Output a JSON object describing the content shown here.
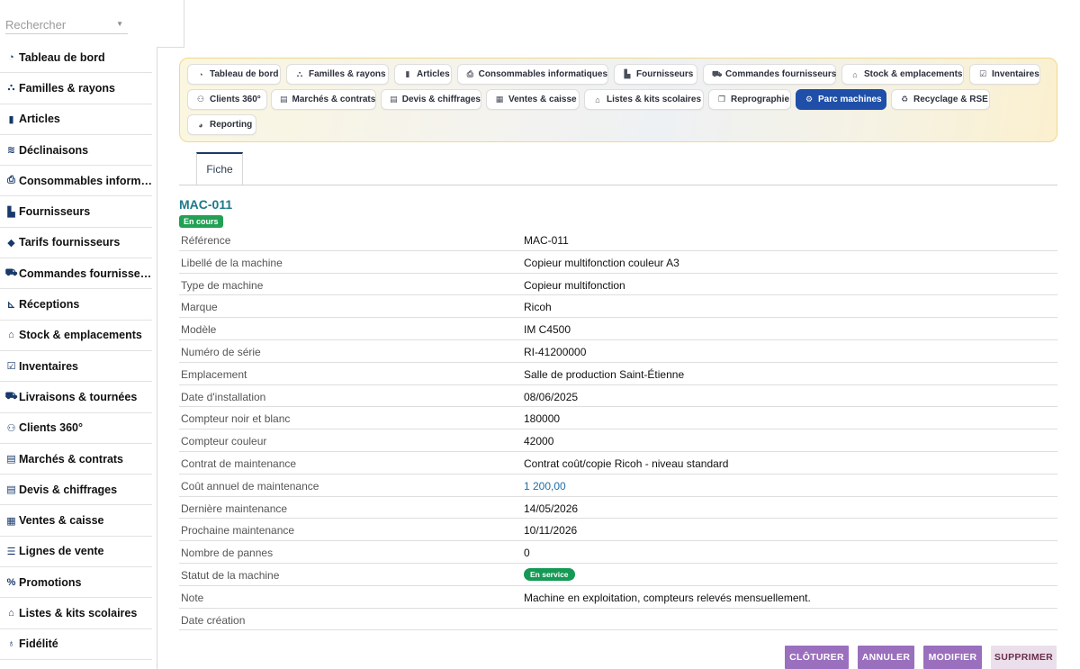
{
  "search": {
    "placeholder": "Rechercher"
  },
  "sidebar": {
    "items": [
      {
        "label": "Tableau de bord",
        "icon": "gauge-icon"
      },
      {
        "label": "Familles & rayons",
        "icon": "sitemap-icon"
      },
      {
        "label": "Articles",
        "icon": "book-icon"
      },
      {
        "label": "Déclinaisons",
        "icon": "layers-icon"
      },
      {
        "label": "Consommables informatiques",
        "icon": "printer-icon"
      },
      {
        "label": "Fournisseurs",
        "icon": "truck-loading-icon"
      },
      {
        "label": "Tarifs fournisseurs",
        "icon": "tags-icon"
      },
      {
        "label": "Commandes fournisseurs",
        "icon": "cart-icon"
      },
      {
        "label": "Réceptions",
        "icon": "dolly-icon"
      },
      {
        "label": "Stock & emplacements",
        "icon": "warehouse-icon"
      },
      {
        "label": "Inventaires",
        "icon": "clipboard-check-icon"
      },
      {
        "label": "Livraisons & tournées",
        "icon": "truck-icon"
      },
      {
        "label": "Clients 360°",
        "icon": "users-icon"
      },
      {
        "label": "Marchés & contrats",
        "icon": "contract-icon"
      },
      {
        "label": "Devis & chiffrages",
        "icon": "file-invoice-icon"
      },
      {
        "label": "Ventes & caisse",
        "icon": "cash-register-icon"
      },
      {
        "label": "Lignes de vente",
        "icon": "list-icon"
      },
      {
        "label": "Promotions",
        "icon": "percent-icon"
      },
      {
        "label": "Listes & kits scolaires",
        "icon": "graduation-cap-icon"
      },
      {
        "label": "Fidélité",
        "icon": "award-icon"
      }
    ]
  },
  "modules": [
    {
      "label": "Tableau de bord",
      "icon": "gauge-icon",
      "active": false
    },
    {
      "label": "Familles & rayons",
      "icon": "sitemap-icon",
      "active": false
    },
    {
      "label": "Articles",
      "icon": "book-icon",
      "active": false
    },
    {
      "label": "Consommables informatiques",
      "icon": "printer-icon",
      "active": false
    },
    {
      "label": "Fournisseurs",
      "icon": "truck-loading-icon",
      "active": false
    },
    {
      "label": "Commandes fournisseurs",
      "icon": "cart-icon",
      "active": false
    },
    {
      "label": "Stock & emplacements",
      "icon": "warehouse-icon",
      "active": false
    },
    {
      "label": "Inventaires",
      "icon": "clipboard-check-icon",
      "active": false
    },
    {
      "label": "Clients 360°",
      "icon": "users-icon",
      "active": false
    },
    {
      "label": "Marchés & contrats",
      "icon": "contract-icon",
      "active": false
    },
    {
      "label": "Devis & chiffrages",
      "icon": "file-invoice-icon",
      "active": false
    },
    {
      "label": "Ventes & caisse",
      "icon": "cash-register-icon",
      "active": false
    },
    {
      "label": "Listes & kits scolaires",
      "icon": "graduation-cap-icon",
      "active": false
    },
    {
      "label": "Reprographie",
      "icon": "copy-icon",
      "active": false
    },
    {
      "label": "Parc machines",
      "icon": "cogs-icon",
      "active": true
    },
    {
      "label": "Recyclage & RSE",
      "icon": "recycle-icon",
      "active": false
    },
    {
      "label": "Reporting",
      "icon": "chart-pie-icon",
      "active": false
    }
  ],
  "tabs": {
    "fiche": "Fiche"
  },
  "record": {
    "title": "MAC-011",
    "status_badge": "En cours",
    "fields": [
      {
        "key": "Référence",
        "value": "MAC-011"
      },
      {
        "key": "Libellé de la machine",
        "value": "Copieur multifonction couleur A3"
      },
      {
        "key": "Type de machine",
        "value": "Copieur multifonction"
      },
      {
        "key": "Marque",
        "value": "Ricoh"
      },
      {
        "key": "Modèle",
        "value": "IM C4500"
      },
      {
        "key": "Numéro de série",
        "value": "RI-41200000"
      },
      {
        "key": "Emplacement",
        "value": "Salle de production Saint-Étienne"
      },
      {
        "key": "Date d'installation",
        "value": "08/06/2025"
      },
      {
        "key": "Compteur noir et blanc",
        "value": "180000"
      },
      {
        "key": "Compteur couleur",
        "value": "42000"
      },
      {
        "key": "Contrat de maintenance",
        "value": "Contrat coût/copie Ricoh - niveau standard"
      },
      {
        "key": "Coût annuel de maintenance",
        "value": "1 200,00"
      },
      {
        "key": "Dernière maintenance",
        "value": "14/05/2026"
      },
      {
        "key": "Prochaine maintenance",
        "value": "10/11/2026"
      },
      {
        "key": "Nombre de pannes",
        "value": "0"
      },
      {
        "key": "Statut de la machine",
        "value": "En service"
      },
      {
        "key": "Note",
        "value": "Machine en exploitation, compteurs relevés mensuellement."
      },
      {
        "key": "Date création",
        "value": ""
      }
    ]
  },
  "actions": {
    "close": "CLÔTURER",
    "cancel": "ANNULER",
    "edit": "MODIFIER",
    "delete": "SUPPRIMER"
  },
  "colors": {
    "accent": "#1f4fa8",
    "title": "#1d7a89",
    "success": "#22a155",
    "button": "#9a6fbd"
  }
}
